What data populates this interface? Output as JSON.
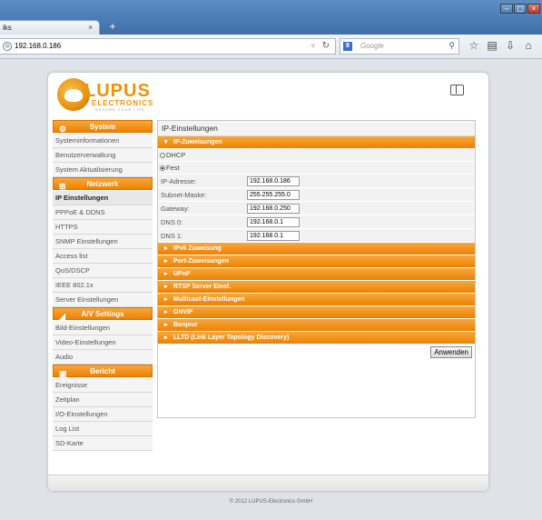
{
  "browser": {
    "tab_title": "iks",
    "tab_close": "×",
    "new_tab": "+",
    "url": "192.168.0.186",
    "search_placeholder": "Google",
    "window_buttons": [
      "–",
      "▢",
      "×"
    ]
  },
  "brand": {
    "name": "LUPUS",
    "sub": "ELECTRONICS",
    "tagline": "SECURE YOUR LIFE"
  },
  "sidebar": {
    "sections": [
      {
        "title": "System",
        "icon": "gear-icon",
        "items": [
          "Systeminformationen",
          "Benutzerverwaltung",
          "System Aktualisierung"
        ]
      },
      {
        "title": "Netzwerk",
        "icon": "network-icon",
        "items": [
          "IP Einstellungen",
          "PPPoE & DDNS",
          "HTTPS",
          "SNMP Einstellungen",
          "Access list",
          "QoS/DSCP",
          "IEEE 802.1x",
          "Server Einstellungen"
        ]
      },
      {
        "title": "A/V Settings",
        "icon": "camera-icon",
        "items": [
          "Bild-Einstellungen",
          "Video-Einstellungen",
          "Audio"
        ]
      },
      {
        "title": "Bericht",
        "icon": "report-icon",
        "items": [
          "Ereignisse",
          "Zeitplan",
          "I/O-Einstellungen",
          "Log List",
          "SD-Karte"
        ]
      }
    ],
    "active_item": "IP Einstellungen"
  },
  "content": {
    "title": "IP-Einstellungen",
    "ip_section": "IP-Zuweisungen",
    "options": {
      "dhcp": "DHCP",
      "fest": "Fest",
      "selected": "Fest"
    },
    "fields": [
      {
        "label": "IP-Adresse:",
        "value": "192.168.0.186"
      },
      {
        "label": "Subnet-Maske:",
        "value": "255.255.255.0"
      },
      {
        "label": "Gateway:",
        "value": "192.168.0.250"
      },
      {
        "label": "DNS 0:",
        "value": "192.168.0.1"
      },
      {
        "label": "DNS 1:",
        "value": "192.168.0.1"
      }
    ],
    "sections": [
      "IPv6 Zuweisung",
      "Port-Zuweisungen",
      "UPnP",
      "RTSP Server Einst.",
      "Multicast-Einstellungen",
      "ONVIF",
      "Bonjour",
      "LLTD (Link Layer Topology Discovery)"
    ],
    "apply_label": "Anwenden"
  },
  "footer": {
    "copyright": "© 2012 LUPUS-Electronics GmbH"
  },
  "colors": {
    "accent": "#ee8100",
    "page_bg": "#dfe3e8"
  }
}
